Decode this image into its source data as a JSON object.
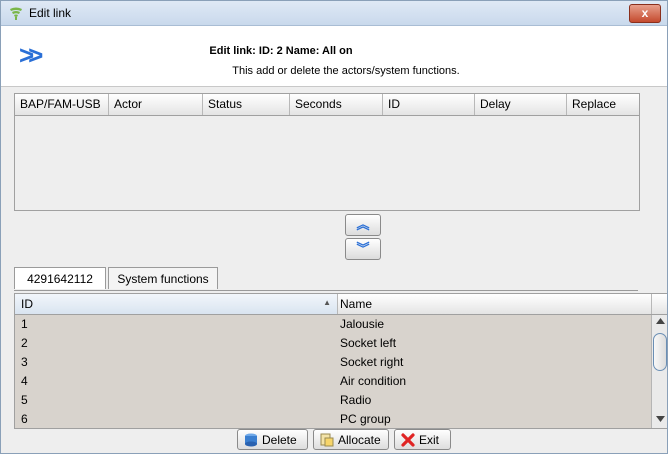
{
  "window": {
    "title": "Edit link",
    "close_label": "x"
  },
  "header": {
    "title": "Edit link: ID: 2 Name: All on",
    "subtitle": "This add or delete the actors/system functions."
  },
  "link_table": {
    "columns": [
      "BAP/FAM-USB",
      "Actor",
      "Status",
      "Seconds",
      "ID",
      "Delay",
      "Replace"
    ]
  },
  "move_buttons": {
    "up": "︽",
    "down": "︾"
  },
  "tabs": [
    "4291642112",
    "System functions"
  ],
  "function_table": {
    "columns": [
      "ID",
      "Name"
    ],
    "sort_indicator": "▲",
    "rows": [
      {
        "id": "1",
        "name": "Jalousie"
      },
      {
        "id": "2",
        "name": "Socket left"
      },
      {
        "id": "3",
        "name": "Socket right"
      },
      {
        "id": "4",
        "name": "Air condition"
      },
      {
        "id": "5",
        "name": "Radio"
      },
      {
        "id": "6",
        "name": "PC group"
      }
    ]
  },
  "buttons": {
    "delete": "Delete",
    "allocate": "Allocate",
    "exit": "Exit"
  },
  "colors": {
    "accent": "#2a6fd6",
    "table_bg": "#d8d3cd",
    "close": "#c44a2e"
  }
}
